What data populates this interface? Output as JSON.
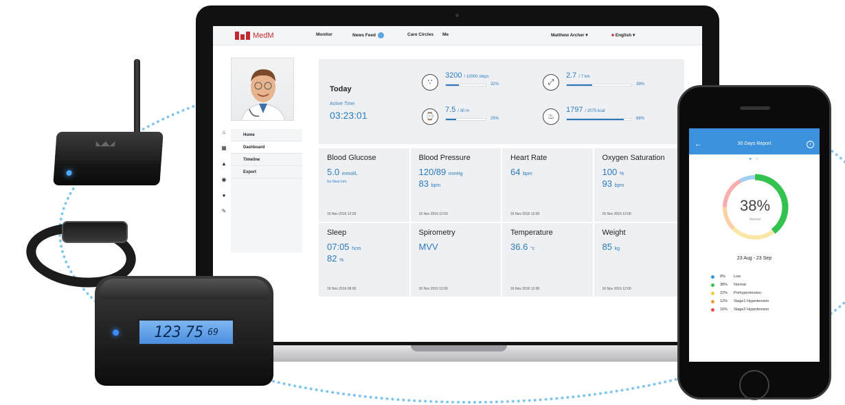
{
  "app": {
    "brand": "MedM",
    "nav": [
      "Monitor",
      "News Feed",
      "Care Circles",
      "Me"
    ],
    "user": "Matthew Archer",
    "language": "English"
  },
  "sidebar": {
    "items": [
      "Home",
      "Dashboard",
      "Timeline",
      "Export"
    ]
  },
  "today": {
    "title": "Today",
    "active_label": "Active Time",
    "active_time": "03:23:01",
    "steps": {
      "value": "3200",
      "goal": "/ 10000 steps",
      "pct": "32%",
      "fraction": 0.32
    },
    "distance": {
      "value": "2.7",
      "goal": "/ 7 km",
      "pct": "39%",
      "fraction": 0.39
    },
    "duration": {
      "value": "7.5",
      "goal": "/ 30 m",
      "pct": "25%",
      "fraction": 0.25
    },
    "calories": {
      "value": "1797",
      "goal": "/ 2075 kcal",
      "pct": "88%",
      "fraction": 0.88
    }
  },
  "cards": [
    {
      "title": "Blood Glucose",
      "value": "5.0",
      "unit": "mmol/L",
      "note": "No Meal Info",
      "date": "16 Nov 2016 12:03"
    },
    {
      "title": "Blood Pressure",
      "value": "120/89",
      "unit": "mmHg",
      "value2": "83",
      "unit2": "bpm",
      "date": "16 Nov 2016 12:03"
    },
    {
      "title": "Heart Rate",
      "value": "64",
      "unit": "bpm",
      "date": "16 Nov 2016 12:00"
    },
    {
      "title": "Oxygen Saturation",
      "value": "100",
      "unit": "%",
      "value2": "93",
      "unit2": "bpm",
      "date": "16 Nov 2016 12:00"
    },
    {
      "title": "Sleep",
      "value": "07:05",
      "unit": "hcm",
      "value2": "82",
      "unit2": "%",
      "date": "16 Nov 2016 08:00"
    },
    {
      "title": "Spirometry",
      "value": "MVV",
      "unit": "",
      "date": "16 Nov 2016 12:00"
    },
    {
      "title": "Temperature",
      "value": "36.6",
      "unit": "°c",
      "date": "16 Nov 2016 12:00"
    },
    {
      "title": "Weight",
      "value": "85",
      "unit": "kg",
      "date": "16 Nov 2016 12:00"
    }
  ],
  "phone": {
    "title": "30 Days Report",
    "center_value": "38%",
    "center_label": "Normal",
    "range": "23 Aug - 23 Sep",
    "legend": [
      {
        "pct": "8%",
        "label": "Low",
        "color": "#2f97e6",
        "value": 8
      },
      {
        "pct": "38%",
        "label": "Normal",
        "color": "#32c24d",
        "value": 38
      },
      {
        "pct": "22%",
        "label": "Prehypertension",
        "color": "#f5c93a",
        "value": 22
      },
      {
        "pct": "12%",
        "label": "Stage1 Hypertension",
        "color": "#f59a3a",
        "value": 12
      },
      {
        "pct": "16%",
        "label": "Stage2 Hypertension",
        "color": "#ef4b4b",
        "value": 16
      }
    ]
  },
  "device": {
    "lcd_left": "123",
    "lcd_mid": "75",
    "lcd_right": "69"
  },
  "colors": {
    "accent": "#2a7ac0",
    "brand": "#c0292d",
    "phone_header": "#3c92dc"
  }
}
